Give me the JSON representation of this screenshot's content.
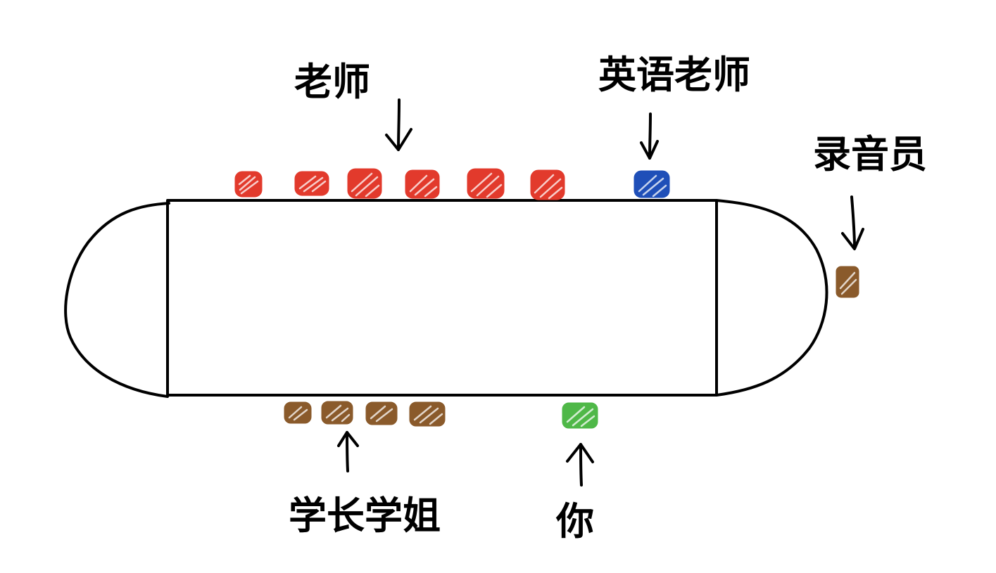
{
  "labels": {
    "teachers": "老师",
    "english_teacher": "英语老师",
    "recorder": "录音员",
    "seniors": "学长学姐",
    "you": "你"
  },
  "colors": {
    "teacher": "#e23a2c",
    "english_teacher": "#1f4fb8",
    "senior": "#8a5a2b",
    "recorder": "#8a5a2b",
    "you": "#4fb848",
    "outline": "#000000"
  },
  "seat_counts": {
    "teachers": 6,
    "english_teacher": 1,
    "seniors": 4,
    "you": 1,
    "recorder": 1
  }
}
